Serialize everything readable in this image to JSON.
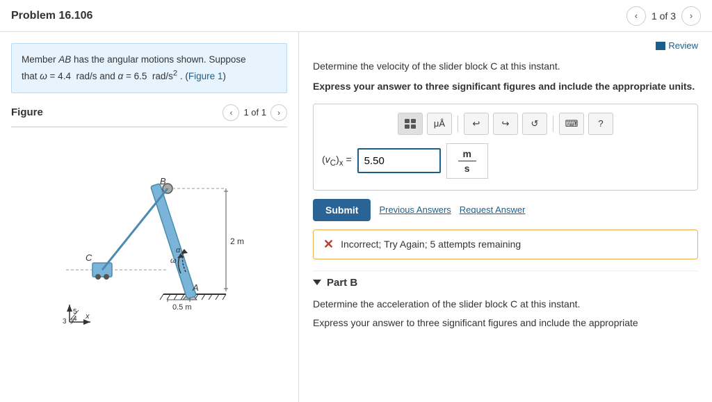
{
  "header": {
    "title": "Problem 16.106",
    "nav": {
      "prev_label": "‹",
      "next_label": "›",
      "page_indicator": "1 of 3"
    }
  },
  "left_panel": {
    "problem_statement": {
      "line1": "Member AB has the angular motions shown. Suppose",
      "line2_prefix": "that ω = 4.4  rad/s and α = 6.5  rad/s",
      "line2_sup": "2",
      "line2_suffix": " . (Figure 1)"
    },
    "figure": {
      "label": "Figure",
      "nav": {
        "prev_label": "‹",
        "page_indicator": "1 of 1",
        "next_label": "›"
      }
    }
  },
  "right_panel": {
    "review": {
      "label": "Review"
    },
    "question_text": "Determine the velocity of the slider block C at this instant.",
    "instruction": "Express your answer to three significant figures and include the appropriate units.",
    "toolbar": {
      "btn1": "⊞",
      "btn2": "μÅ",
      "undo": "↩",
      "redo": "↪",
      "reset": "↺",
      "keyboard": "⌨",
      "help": "?"
    },
    "input": {
      "label": "(vC)x =",
      "value": "5.50",
      "placeholder": ""
    },
    "units": {
      "numerator": "m",
      "denominator": "s"
    },
    "actions": {
      "submit": "Submit",
      "previous_answers": "Previous Answers",
      "request_answer": "Request Answer"
    },
    "feedback": {
      "icon": "✕",
      "message": "Incorrect; Try Again; 5 attempts remaining"
    },
    "part_b": {
      "label": "Part B",
      "text": "Determine the acceleration of the slider block C at this instant.",
      "instruction_partial": "Express your answer to three significant figures and include the appropriate"
    }
  }
}
